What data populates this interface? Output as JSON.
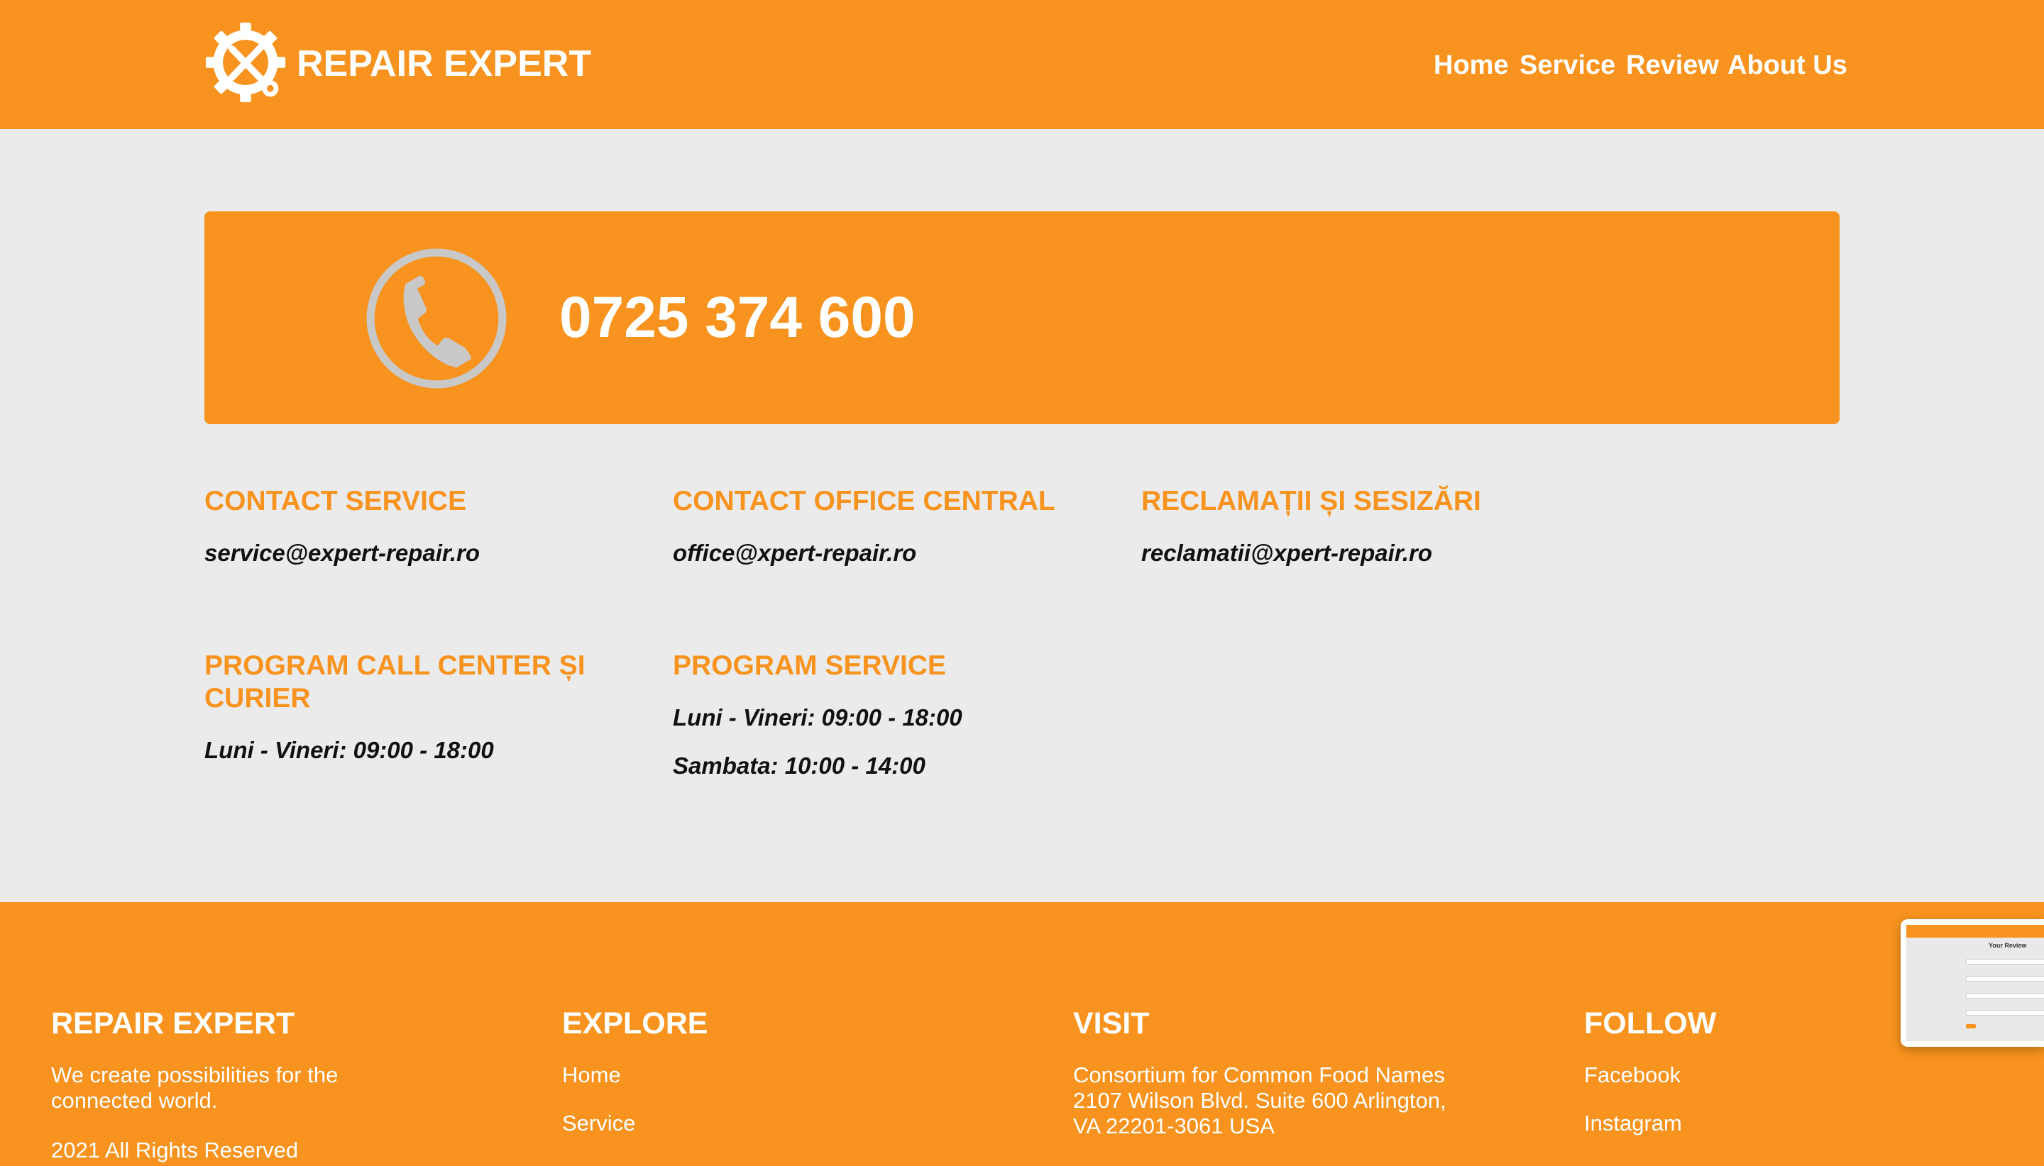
{
  "header": {
    "brand": "REPAIR EXPERT",
    "nav": [
      "Home",
      "Service",
      "Review",
      "About Us"
    ],
    "logo_icon": "gear-wrench-icon"
  },
  "phone_banner": {
    "number": "0725 374 600",
    "icon": "phone-icon"
  },
  "contacts": [
    {
      "title": "CONTACT SERVICE",
      "lines": [
        "service@expert-repair.ro"
      ]
    },
    {
      "title": "CONTACT OFFICE CENTRAL",
      "lines": [
        "office@xpert-repair.ro"
      ]
    },
    {
      "title": "RECLAMAȚII ȘI SESIZĂRI",
      "lines": [
        "reclamatii@xpert-repair.ro"
      ]
    },
    {
      "title": "PROGRAM CALL CENTER ȘI CURIER",
      "lines": [
        "Luni - Vineri: 09:00 - 18:00"
      ]
    },
    {
      "title": "PROGRAM SERVICE",
      "lines": [
        "Luni - Vineri: 09:00 - 18:00",
        "Sambata: 10:00 - 14:00"
      ]
    }
  ],
  "footer": {
    "about": {
      "title": "REPAIR EXPERT",
      "text": "We create possibilities for the connected world.",
      "copyright": "2021 All Rights Reserved"
    },
    "explore": {
      "title": "EXPLORE",
      "links": [
        "Home",
        "Service"
      ]
    },
    "visit": {
      "title": "VISIT",
      "address": [
        "Consortium for Common Food Names",
        "2107 Wilson Blvd. Suite 600 Arlington,",
        "VA 22201-3061 USA"
      ]
    },
    "follow": {
      "title": "FOLLOW",
      "links": [
        "Facebook",
        "Instagram"
      ]
    }
  },
  "preview": {
    "title": "Your Review"
  },
  "colors": {
    "accent": "#f7931e",
    "background": "#ebebeb",
    "phone_icon": "#c8c8c8"
  }
}
